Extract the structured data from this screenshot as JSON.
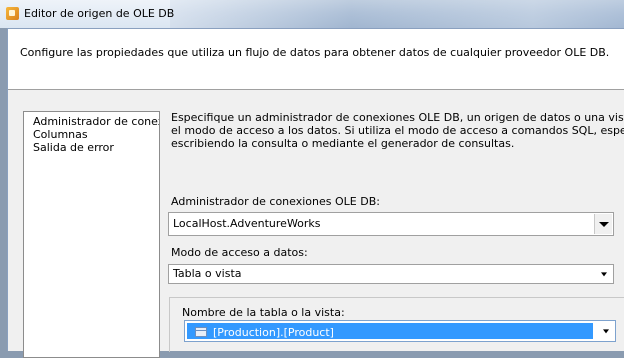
{
  "window": {
    "title": "Editor de origen de OLE DB"
  },
  "header": {
    "description": "Configure las propiedades que utiliza un flujo de datos para obtener datos de cualquier proveedor OLE DB."
  },
  "nav": {
    "items": [
      {
        "label": "Administrador de conexiones"
      },
      {
        "label": "Columnas"
      },
      {
        "label": "Salida de error"
      }
    ]
  },
  "main": {
    "intro_lines": [
      "Especifique un administrador de conexiones OLE DB, un origen de datos o una vista del origen de datos y seleccione",
      "el modo de acceso a los datos. Si utiliza el modo de acceso a comandos SQL, especifique el comando SQL",
      "escribiendo la consulta o mediante el generador de consultas."
    ],
    "connection_label": "Administrador de conexiones OLE DB:",
    "connection_value": "LocalHost.AdventureWorks",
    "access_mode_label": "Modo de acceso a datos:",
    "access_mode_value": "Tabla o vista",
    "table_label": "Nombre de la tabla o la vista:",
    "table_value": "[Production].[Product]"
  },
  "icons": {
    "app": "ssis-source-icon",
    "table": "table-icon",
    "dropdown": "chevron-down-icon"
  },
  "colors": {
    "selection": "#3399ff",
    "window_bg": "#f0f0f0",
    "header_bg": "#ffffff"
  }
}
